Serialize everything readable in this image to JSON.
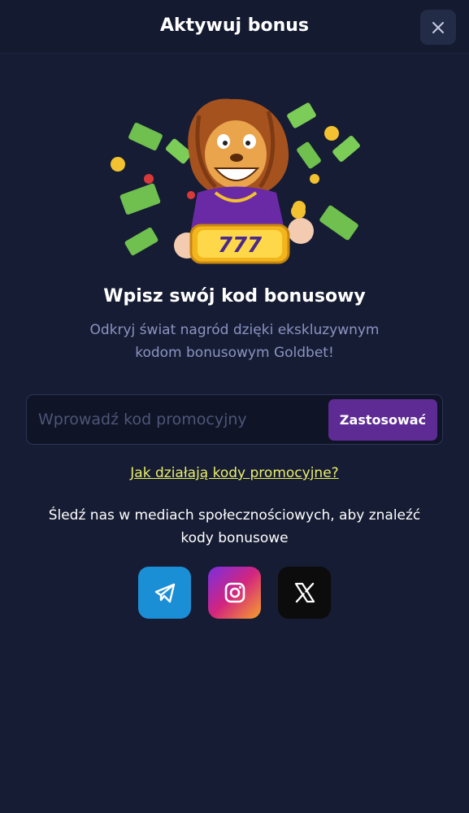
{
  "header": {
    "title": "Aktywuj bonus"
  },
  "hero": {
    "reel_text": "777"
  },
  "main": {
    "headline": "Wpisz swój kod bonusowy",
    "subtitle_line1": "Odkryj świat nagród dzięki ekskluzywnym",
    "subtitle_line2": "kodom bonusowym Goldbet!"
  },
  "promo": {
    "placeholder": "Wprowadź kod promocyjny",
    "apply_label": "Zastosować"
  },
  "link": {
    "how_codes_work": "Jak działają kody promocyjne?"
  },
  "social": {
    "follow_line1": "Śledź nas w mediach społecznościowych, aby znaleźć",
    "follow_line2": "kody bonusowe",
    "items": [
      {
        "icon": "telegram-icon",
        "color": "#1b8fd6"
      },
      {
        "icon": "instagram-icon",
        "color": "#d2257e"
      },
      {
        "icon": "x-icon",
        "color": "#0c0c0c"
      }
    ]
  },
  "colors": {
    "background": "#161c33",
    "accent_button": "#5e2b94",
    "link": "#e9ef67",
    "subtitle": "#8b94c2"
  }
}
